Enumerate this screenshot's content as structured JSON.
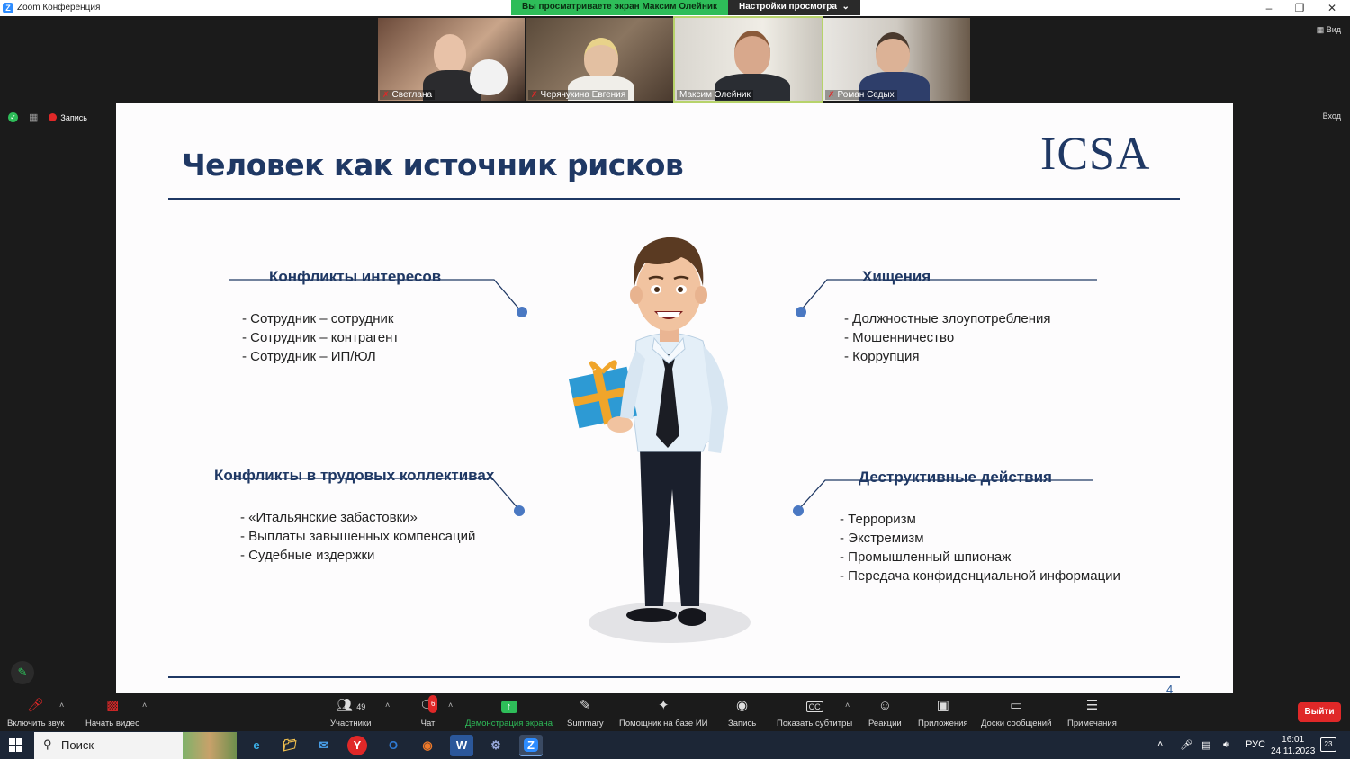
{
  "window": {
    "title": "Zoom Конференция"
  },
  "share_banner": {
    "viewing": "Вы просматриваете экран Максим Олейник",
    "settings": "Настройки просмотра"
  },
  "view_button": "Вид",
  "enter_button": "Вход",
  "recording_label": "Запись",
  "participants_strip": [
    {
      "name": "Светлана",
      "muted": true
    },
    {
      "name": "Черячукина Евгения",
      "muted": true
    },
    {
      "name": "Максим Олейник",
      "muted": false
    },
    {
      "name": "Роман Седых",
      "muted": true
    }
  ],
  "slide": {
    "title": "Человек как источник рисков",
    "logo": "ICSA",
    "page_number": "4",
    "blocks": [
      {
        "title": "Конфликты интересов",
        "items": [
          "- Сотрудник – сотрудник",
          "- Сотрудник – контрагент",
          "- Сотрудник – ИП/ЮЛ"
        ]
      },
      {
        "title": "Хищения",
        "items": [
          "- Должностные злоупотребления",
          "- Мошенничество",
          "- Коррупция"
        ]
      },
      {
        "title": "Конфликты в трудовых коллективах",
        "items": [
          "- «Итальянские забастовки»",
          "- Выплаты завышенных компенсаций",
          "- Судебные издержки"
        ]
      },
      {
        "title": "Деструктивные действия",
        "items": [
          "- Терроризм",
          "- Экстремизм",
          "- Промышленный шпионаж",
          "- Передача конфиденциальной информации"
        ]
      }
    ]
  },
  "toolbar": {
    "unmute": "Включить звук",
    "start_video": "Начать видео",
    "participants": "Участники",
    "participants_count": "49",
    "chat": "Чат",
    "chat_badge": "6",
    "share_screen": "Демонстрация экрана",
    "summary": "Summary",
    "ai_assistant": "Помощник на базе ИИ",
    "record": "Запись",
    "captions": "Показать субтитры",
    "reactions": "Реакции",
    "apps": "Приложения",
    "whiteboards": "Доски сообщений",
    "notes": "Примечания",
    "leave": "Выйти"
  },
  "taskbar": {
    "search": "Поиск",
    "language": "РУС",
    "time": "16:01",
    "date": "24.11.2023",
    "notifications": "23"
  },
  "colors": {
    "accent": "#1f3864",
    "green": "#2ebd59",
    "red": "#e02828",
    "dot": "#4a78c2"
  }
}
